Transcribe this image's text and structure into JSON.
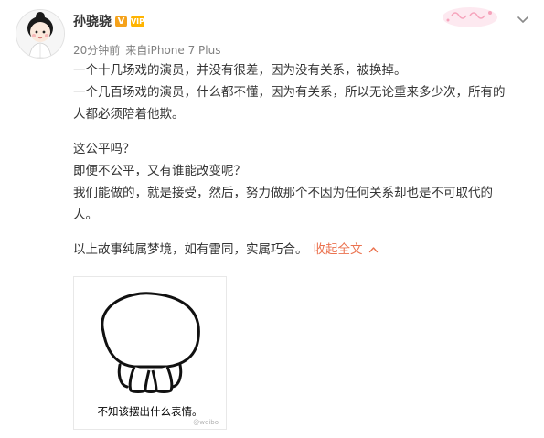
{
  "post": {
    "username": "孙骁骁",
    "verified_badge": "V",
    "vip_badge": "VIP",
    "time": "20分钟前",
    "device": "来自iPhone 7 Plus",
    "paragraphs": [
      [
        "一个十几场戏的演员，并没有很差，因为没有关系，被换掉。",
        "一个几百场戏的演员，什么都不懂，因为有关系，所以无论重来多少次，所有的",
        "人都必须陪着他欺。"
      ],
      [
        "这公平吗？",
        "即便不公平，又有谁能改变呢？",
        "我们能做的，就是接受，然后，努力做那个不因为任何关系却也是不可取代的",
        "人。"
      ],
      [
        "以上故事纯属梦境，如有雷同，实属巧合。"
      ]
    ],
    "collapse_label": "收起全文",
    "collapse_caret": "^",
    "image": {
      "caption": "不知该摆出什么表情。",
      "watermark": "@weibo"
    },
    "icons": {
      "avatar": "avatar-icon",
      "menu": "chevron-down-icon",
      "decoration": "card-decoration-icon"
    },
    "colors": {
      "link": "#eb7350",
      "verified": "#f5a21b",
      "meta": "#808080",
      "text": "#333333"
    }
  }
}
